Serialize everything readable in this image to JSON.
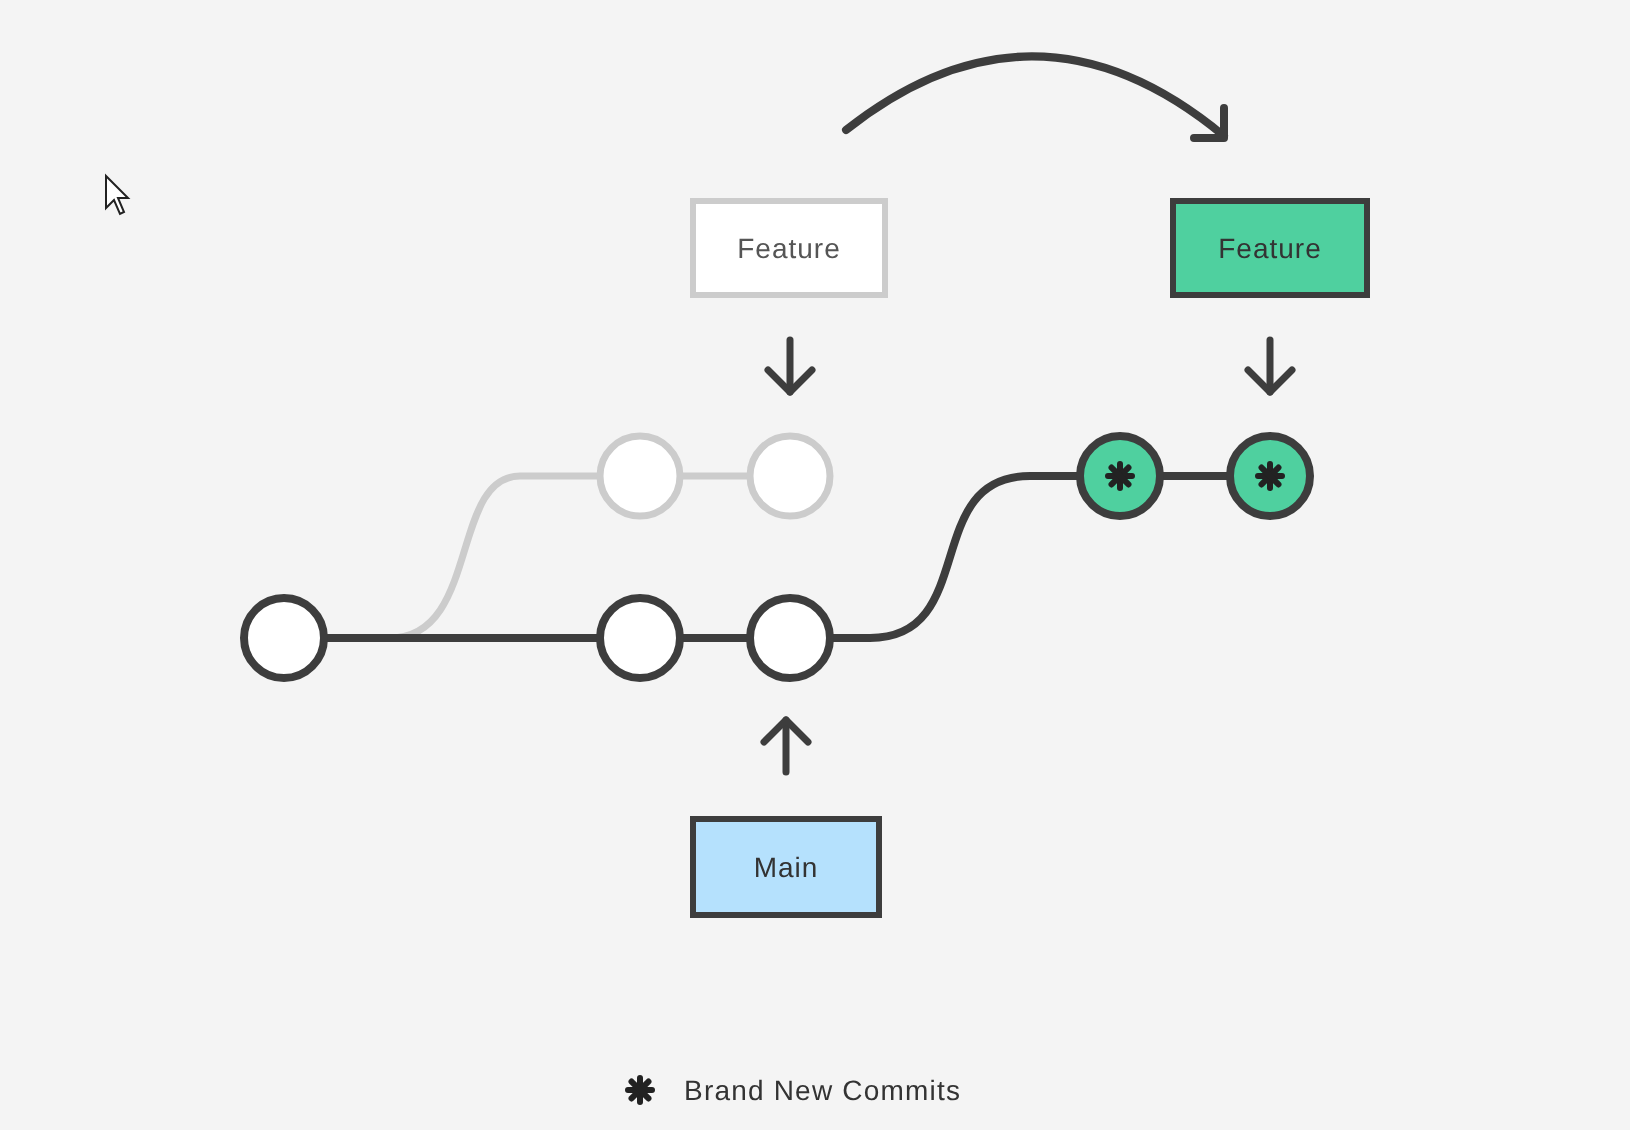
{
  "branch_labels": [
    {
      "kind": "ghost",
      "text": "Feature"
    },
    {
      "kind": "rebased",
      "text": "Feature"
    },
    {
      "kind": "main",
      "text": "Main"
    }
  ],
  "commits": [
    {
      "kind": "base"
    },
    {
      "kind": "ghost"
    },
    {
      "kind": "ghost"
    },
    {
      "kind": "base"
    },
    {
      "kind": "base"
    },
    {
      "kind": "new"
    },
    {
      "kind": "new"
    }
  ],
  "legend": {
    "text": "Brand New Commits"
  }
}
